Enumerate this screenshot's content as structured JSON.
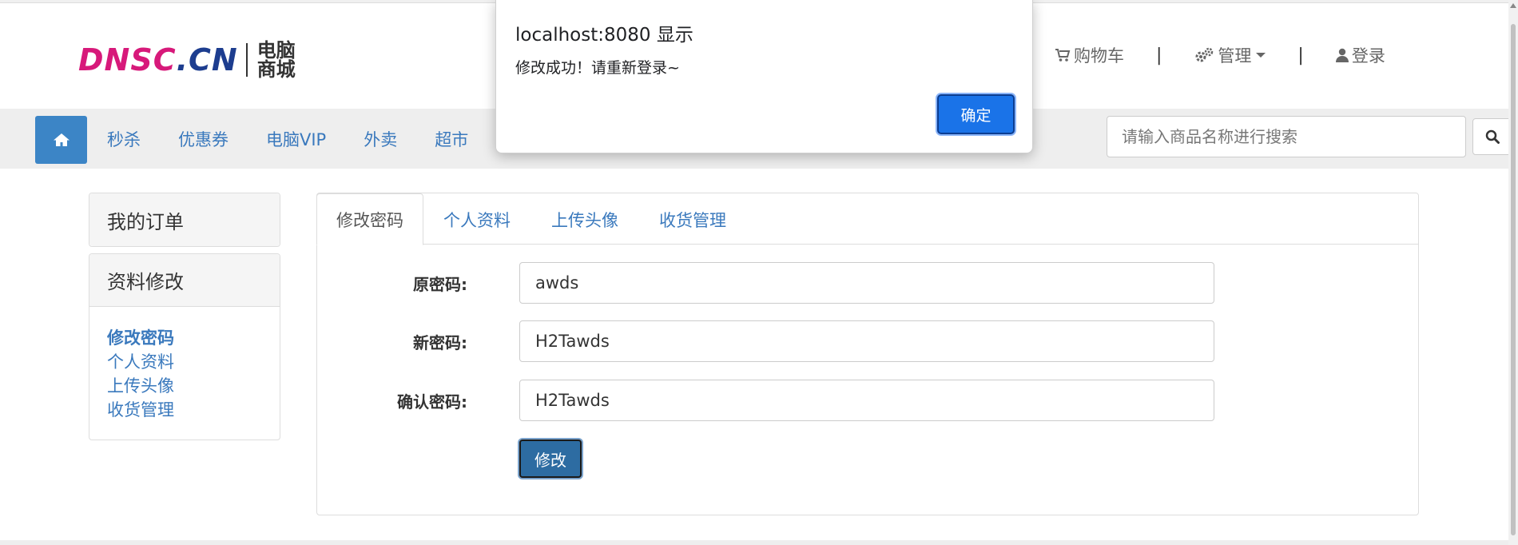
{
  "brand": {
    "logo_part1": "DNSC",
    "logo_dot": ".",
    "logo_part2": "CN",
    "cn_line1": "电脑",
    "cn_line2": "商城"
  },
  "header_nav": {
    "cart_label": "购物车",
    "manage_label": "管理",
    "login_label": "登录",
    "separator": "|"
  },
  "category_nav": {
    "items": [
      "秒杀",
      "优惠券",
      "电脑VIP",
      "外卖",
      "超市"
    ]
  },
  "search": {
    "placeholder": "请输入商品名称进行搜索",
    "value": ""
  },
  "sidebar": {
    "my_orders": "我的订单",
    "profile_edit": "资料修改",
    "links": [
      "修改密码",
      "个人资料",
      "上传头像",
      "收货管理"
    ],
    "active_index": 0
  },
  "tabs": {
    "items": [
      "修改密码",
      "个人资料",
      "上传头像",
      "收货管理"
    ],
    "active_index": 0
  },
  "form": {
    "old_password_label": "原密码:",
    "old_password_value": "awds",
    "new_password_label": "新密码:",
    "new_password_value": "H2Tawds",
    "confirm_password_label": "确认密码:",
    "confirm_password_value": "H2Tawds",
    "submit_label": "修改"
  },
  "dialog": {
    "title": "localhost:8080 显示",
    "message": "修改成功！请重新登录~",
    "ok_label": "确定"
  },
  "colors": {
    "primary_link": "#3a79bd",
    "home_button": "#3c85c6",
    "submit_button": "#2d6ca2",
    "dialog_button": "#1a73e8",
    "logo_pink": "#d7197a",
    "logo_navy": "#1d3d8f"
  },
  "icons": {
    "home": "home-icon",
    "cart": "cart-icon",
    "manage": "gears-icon",
    "login": "user-icon",
    "search": "search-icon",
    "dropdown": "caret-down-icon"
  }
}
